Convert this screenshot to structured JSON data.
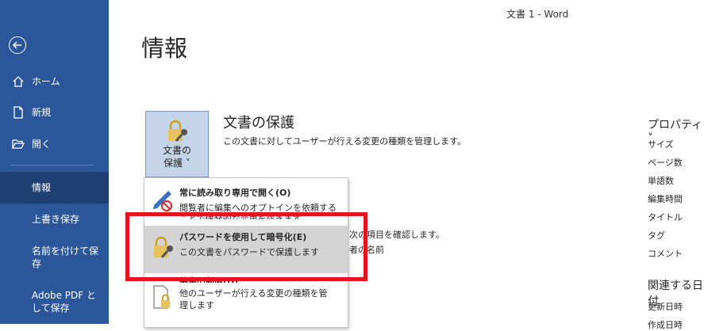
{
  "window": {
    "title": "文書 1  -  Word"
  },
  "sidebar": {
    "items": [
      {
        "label": "ホーム"
      },
      {
        "label": "新規"
      },
      {
        "label": "開く"
      },
      {
        "label": "情報"
      },
      {
        "label": "上書き保存"
      },
      {
        "label": "名前を付けて保存"
      },
      {
        "label": "Adobe PDF として保存"
      }
    ],
    "save_as_line1": "名前を付けて保",
    "save_as_line2": "存",
    "pdf_line1": "Adobe PDF と",
    "pdf_line2": "して保存"
  },
  "main": {
    "page_title": "情報",
    "protect": {
      "button_line1": "文書の",
      "button_line2": "保護 ˅",
      "title": "文書の保護",
      "description": "この文書に対してユーザーが行える変更の種類を管理します。"
    },
    "bg_inspect_fragment": "次の項目を確認します。",
    "bg_author_fragment": "者の名前"
  },
  "properties": {
    "heading": "プロパティ ˅",
    "rows": [
      "サイズ",
      "ページ数",
      "単語数",
      "編集時間",
      "タイトル",
      "タグ",
      "コメント"
    ],
    "related_dates_heading": "関連する日付",
    "date_rows": [
      "更新日時",
      "作成日時"
    ]
  },
  "menu": {
    "items": [
      {
        "title": "常に読み取り専用で開く(O)",
        "desc_line1": "閲覧者に編集へのオプトインを依頼する",
        "desc_line2": "ことで偶発的な変更を防ぎます。"
      },
      {
        "title": "パスワードを使用して暗号化(E)",
        "desc_line1": "この文書をパスワードで保護します"
      },
      {
        "title": "編集の制限(D)",
        "desc_line1": "他のユーザーが行える変更の種類を管",
        "desc_line2": "理します"
      }
    ]
  },
  "colors": {
    "sidebar": "#2b579a",
    "sidebar_active": "#1e3f72",
    "highlight_box": "#e3141c",
    "menu_hover": "#d4d4d4"
  }
}
